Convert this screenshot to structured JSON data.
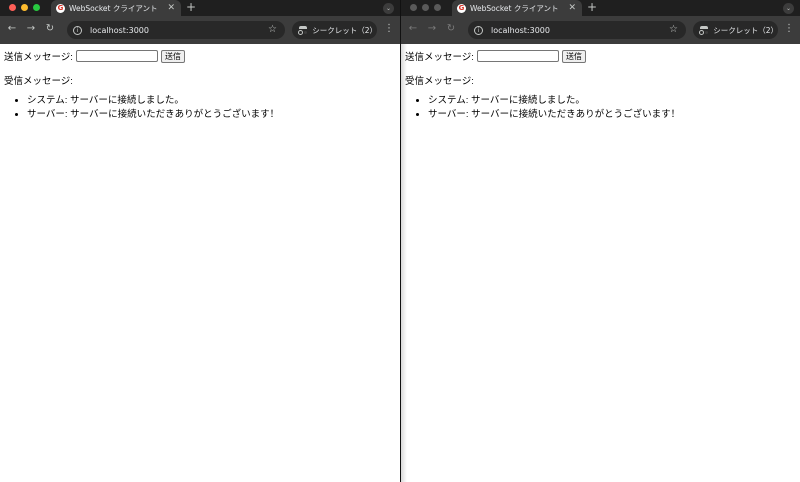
{
  "windows": [
    {
      "id": "left",
      "active": true,
      "tab_title": "WebSocket クライアント",
      "favicon_letter": "G",
      "url": "localhost:3000",
      "incognito_label": "シークレット（2）",
      "page": {
        "send_label": "送信メッセージ:",
        "send_value": "",
        "send_button": "送信",
        "received_label": "受信メッセージ:",
        "messages": [
          "システム: サーバーに接続しました。",
          "サーバー: サーバーに接続いただきありがとうございます！"
        ]
      }
    },
    {
      "id": "right",
      "active": false,
      "tab_title": "WebSocket クライアント",
      "favicon_letter": "G",
      "url": "localhost:3000",
      "incognito_label": "シークレット（2）",
      "page": {
        "send_label": "送信メッセージ:",
        "send_value": "",
        "send_button": "送信",
        "received_label": "受信メッセージ:",
        "messages": [
          "システム: サーバーに接続しました。",
          "サーバー: サーバーに接続いただきありがとうございます！"
        ]
      }
    }
  ],
  "colors": {
    "close": "#ff5f57",
    "minimize": "#febc2e",
    "maximize": "#28c840",
    "inactive_light": "#5a5a5a",
    "favicon": "#d93025"
  },
  "icons": {
    "back": "arrow-left-icon",
    "forward": "arrow-right-icon",
    "reload": "reload-icon",
    "info": "info-icon",
    "bookmark": "star-icon",
    "incognito": "incognito-icon",
    "menu": "kebab-menu-icon",
    "close_tab": "close-icon",
    "new_tab": "plus-icon",
    "tab_search": "chevron-down-icon"
  }
}
